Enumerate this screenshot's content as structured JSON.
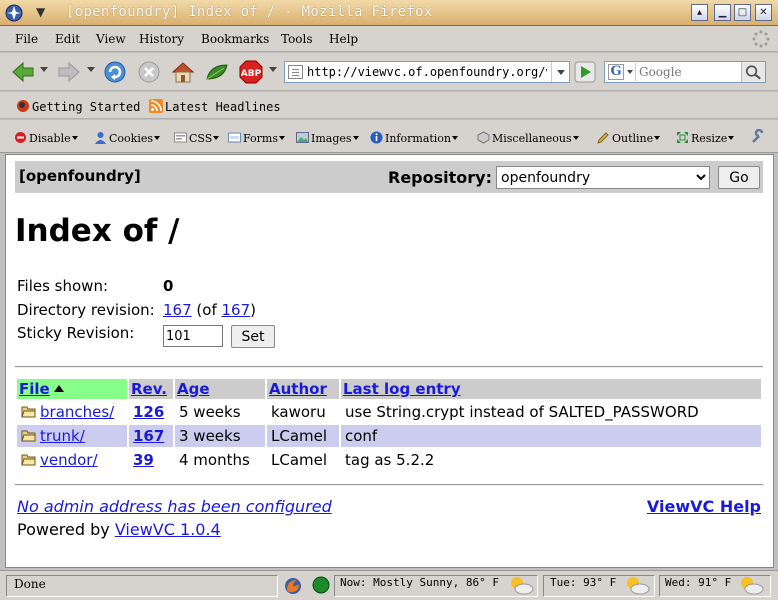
{
  "window": {
    "title": "[openfoundry] Index of / - Mozilla Firefox"
  },
  "menubar": {
    "items": [
      "File",
      "Edit",
      "View",
      "History",
      "Bookmarks",
      "Tools",
      "Help"
    ]
  },
  "navbar": {
    "url": "http://viewvc.of.openfoundry.org/vie",
    "search_placeholder": "Google"
  },
  "bookmarks": {
    "items": [
      "Getting Started",
      "Latest Headlines"
    ]
  },
  "devtoolbar": {
    "items": [
      "Disable",
      "Cookies",
      "CSS",
      "Forms",
      "Images",
      "Information",
      "Miscellaneous",
      "Outline",
      "Resize"
    ]
  },
  "page": {
    "repo_name": "[openfoundry]",
    "repository_label": "Repository:",
    "repository_selected": "openfoundry",
    "go_label": "Go",
    "title": "Index of /",
    "files_shown_label": "Files shown:",
    "files_shown_value": "0",
    "dir_revision_label": "Directory revision:",
    "dir_revision_value": "167",
    "dir_revision_of_prefix": "(of ",
    "dir_revision_of_value": "167",
    "dir_revision_of_suffix": ")",
    "sticky_label": "Sticky Revision:",
    "sticky_value": "101",
    "set_label": "Set",
    "columns": [
      "File",
      "Rev.",
      "Age",
      "Author",
      "Last log entry"
    ],
    "rows": [
      {
        "file": "branches/",
        "rev": "126",
        "age": "5 weeks",
        "author": "kaworu",
        "log": "use String.crypt instead of SALTED_PASSWORD"
      },
      {
        "file": "trunk/",
        "rev": "167",
        "age": "3 weeks",
        "author": "LCamel",
        "log": "conf"
      },
      {
        "file": "vendor/",
        "rev": "39",
        "age": "4 months",
        "author": "LCamel",
        "log": "tag as 5.2.2"
      }
    ],
    "admin_note": "No admin address has been configured",
    "help_link": "ViewVC Help",
    "powered_prefix": "Powered by ",
    "powered_link": "ViewVC 1.0.4"
  },
  "statusbar": {
    "status": "Done",
    "weather_now": "Now: Mostly Sunny, 86° F",
    "weather_tue": "Tue: 93° F",
    "weather_wed": "Wed: 91° F"
  }
}
